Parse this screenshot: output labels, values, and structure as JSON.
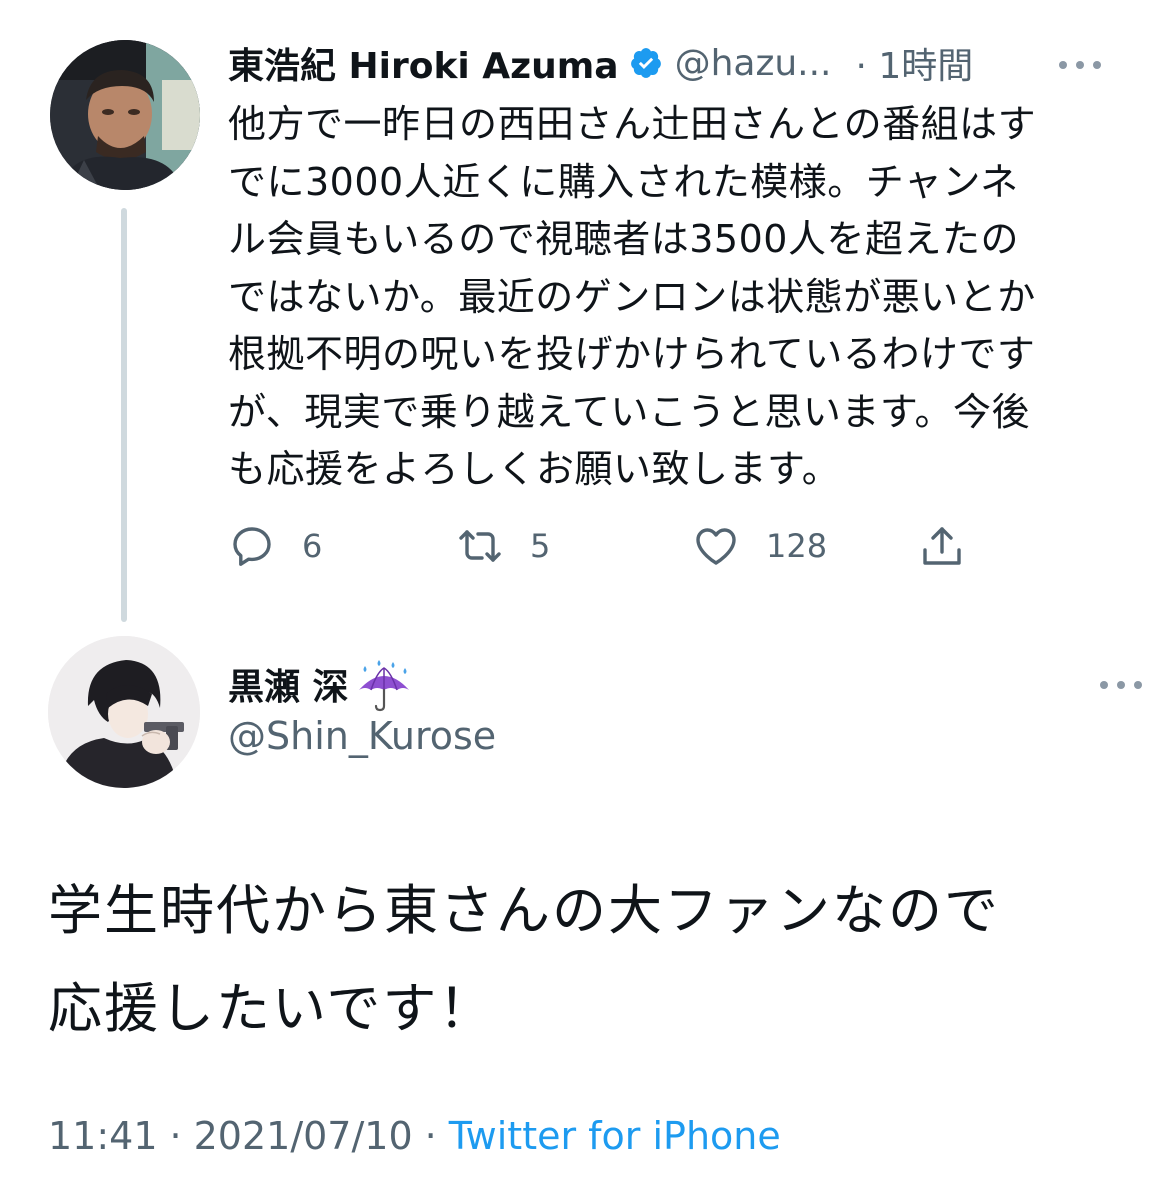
{
  "parent_tweet": {
    "author_name": "東浩紀 Hiroki Azuma",
    "handle": "@hazu...",
    "time": "· 1時間",
    "text": "他方で一昨日の西田さん辻田さんとの番組はすでに3000人近くに購入された模様。チャンネル会員もいるので視聴者は3500人を超えたのではないか。最近のゲンロンは状態が悪いとか根拠不明の呪いを投げかけられているわけですが、現実で乗り越えていこうと思います。今後も応援をよろしくお願い致します。",
    "text_lines": "他方で一昨日の西田さん辻田さんとの番組はす\nでに3000人近くに購入された模様。チャンネ\nル会員もいるので視聴者は3500人を超えたの\nではないか。最近のゲンロンは状態が悪いとか\n根拠不明の呪いを投げかけられているわけです\nが、現実で乗り越えていこうと思います。今後\nも応援をよろしくお願い致します。",
    "reply_count": "6",
    "retweet_count": "5",
    "like_count": "128",
    "icons": {
      "reply": "reply-icon",
      "retweet": "retweet-icon",
      "like": "heart-icon",
      "share": "share-icon",
      "verified": "verified-badge-icon",
      "more": "more-icon"
    }
  },
  "reply_tweet": {
    "author_name": "黒瀬 深",
    "name_emoji": "umbrella-with-rain-drops-icon",
    "handle": "@Shin_Kurose",
    "text_lines": "学生時代から東さんの大ファンなので\n応援したいです！",
    "time": "11:41",
    "separator": "·",
    "date": "2021/07/10",
    "source": "Twitter for iPhone"
  },
  "colors": {
    "text": "#0f1419",
    "secondary": "#536471",
    "accent": "#1d9bf0",
    "thread_line": "#cfd9de",
    "umbrella": "#8e4fd1"
  }
}
